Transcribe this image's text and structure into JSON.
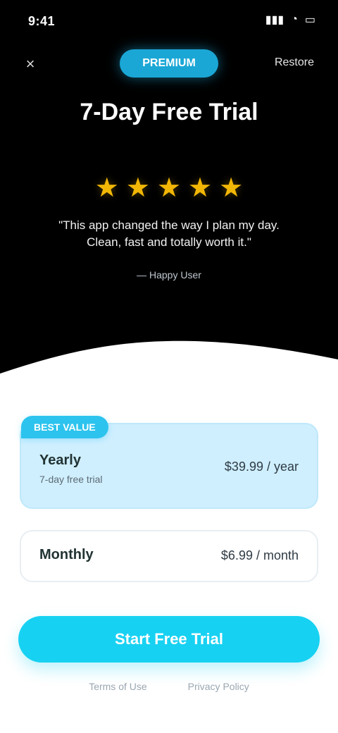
{
  "status_bar": {
    "time": "9:41",
    "signal_icon": "signal-icon",
    "wifi_icon": "wifi-icon",
    "battery_icon": "battery-icon"
  },
  "top": {
    "close_icon": "close-icon",
    "restore_label": "Restore",
    "badge_label": "PREMIUM",
    "title": "7-Day Free Trial"
  },
  "testimonial": {
    "stars": 5,
    "text": "\"This app changed the way I plan my day. Clean, fast and totally worth it.\"",
    "author": "— Happy User"
  },
  "plans": {
    "selected": {
      "badge": "BEST VALUE",
      "name": "Yearly",
      "sub": "7-day free trial",
      "price": "$39.99 / year"
    },
    "other": {
      "name": "Monthly",
      "price": "$6.99 / month"
    }
  },
  "cta": {
    "label": "Start Free Trial"
  },
  "footer": {
    "terms": "Terms of Use",
    "privacy": "Privacy Policy"
  },
  "colors": {
    "accent": "#17d1f2",
    "selected_plan_bg": "#cfefff",
    "star": "#f2b705"
  }
}
